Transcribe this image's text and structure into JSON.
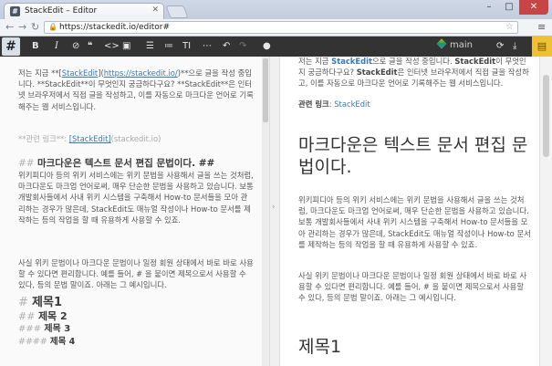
{
  "browser": {
    "tab_title": "StackEdit – Editor",
    "url": "https://stackedit.io/editor#",
    "window_controls": [
      "–",
      "□",
      "✕"
    ]
  },
  "toolbar": {
    "hash": "#",
    "bold": "B",
    "italic": "I",
    "branch": "main",
    "icons": [
      "link-icon",
      "quote-icon",
      "code-icon",
      "image-icon",
      "ordered-list-icon",
      "unordered-list-icon",
      "heading-icon",
      "horizontal-rule-icon",
      "undo-icon",
      "redo-icon",
      "comment-icon",
      "sync-icon",
      "download-icon",
      "folder-icon"
    ]
  },
  "editor": {
    "p1_before": "저는 지금 **[",
    "p1_link_text": "StackEdit",
    "p1_link_mid": "](",
    "p1_link_url": "https://stackedit.io/",
    "p1_after": ")**으로 글을 작성 중입니다. **StackEdit**이 무엇인지 궁금하다구요? **StackEdit**은 인터넷 브라우저에서 직접 글을 작성하고, 이를 자동으로 마크다운 언어로 기록해주는 웹 서비스입니다.",
    "p2_label": "**관련 링크**: ",
    "p2_link_text": "[StackEdit]",
    "p2_link_ref": "(stackedit.io)",
    "h2_mark": "## ",
    "h2_text": "마크다운은 텍스트 문서 편집 문법이다. ##",
    "p3": "위키피디아 등의 위키 서비스에는 위키 문법을 사용해서 글을 쓰는 것처럼, 마크다운도 마크업 언어로써, 매우 단순한 문법을 사용하고 있습니다. 보통 개발회사들에서 사내 위키 시스템을 구축해서 How-to 문서들을 모아 관리하는 경우가 많은데, StackEdit도 매뉴얼 작성이나 How-to 문서를 제작하는 등의 작업을 할 때 유용하게 사용할 수 있죠.",
    "p4": "사실 위키 문법이나 마크다운 문법이나 일정 회원 상태에서 바로 바로 사용할 수 있다면 편리합니다. 예를 들어, # 을 붙이면 제목으로서 사용할 수 있다, 등의 문법 말이죠. 아래는 그 예시입니다.",
    "headings": [
      {
        "mark": "# ",
        "text": "제목1"
      },
      {
        "mark": "## ",
        "text": "제목 2"
      },
      {
        "mark": "### ",
        "text": "제목 3"
      },
      {
        "mark": "#### ",
        "text": "제목 4"
      }
    ]
  },
  "preview": {
    "p1_a": "저는 지금 ",
    "p1_link": "StackEdit",
    "p1_b": "으로 글을 작성 중입니다. ",
    "p1_bold1": "StackEdit",
    "p1_c": "이 무엇인지 궁금하다구요? ",
    "p1_bold2": "StackEdit",
    "p1_d": "은 인터넷 브라우저에서 직접 글을 작성하고, 이를 자동으로 마크다운 언어로 기록해주는 웹 서비스입니다.",
    "p2_label": "관련 링크",
    "p2_sep": ": ",
    "p2_link": "StackEdit",
    "h1": "마크다운은 텍스트 문서 편집 문법이다.",
    "p3": "위키피디아 등의 위키 서비스에는 위키 문법을 사용해서 글을 쓰는 것처럼, 마크다운도 마크업 언어로써, 매우 단순한 문법을 사용하고 있습니다. 보통 개발회사들에서 사내 위키 시스템을 구축해서 How-to 문서들을 모아 관리하는 경우가 많은데, StackEdit도 매뉴얼 작성이나 How-to 문서를 제작하는 등의 작업을 할 때 유용하게 사용할 수 있죠.",
    "p4": "사실 위키 문법이나 마크다운 문법이나 일정 회원 상태에서 바로 바로 사용할 수 있다면 편리합니다. 예를 들어, # 을 붙이면 제목으로서 사용할 수 있다, 등의 문법 말이죠. 아래는 그 예시입니다.",
    "h1b": "제목1"
  }
}
